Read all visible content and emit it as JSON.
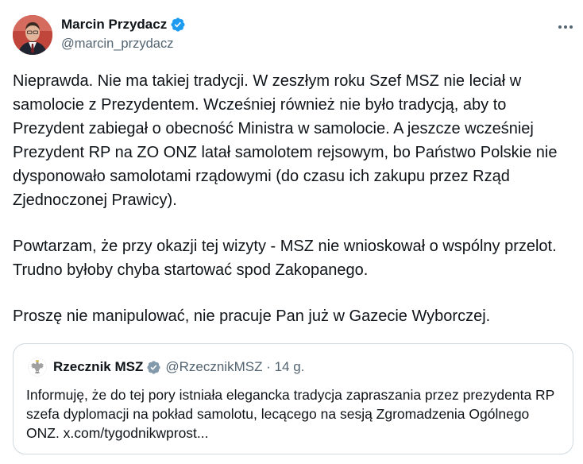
{
  "author": {
    "display_name": "Marcin Przydacz",
    "handle": "@marcin_przydacz"
  },
  "more_icon": "more-horizontal-icon",
  "verified_color": "#1d9bf0",
  "tweet": {
    "paragraphs": [
      "Nieprawda. Nie ma takiej tradycji. W zeszłym roku Szef MSZ nie leciał w samolocie z Prezydentem. Wcześniej również nie było tradycją, aby to Prezydent zabiegał o obecność Ministra w samolocie. A jeszcze wcześniej Prezydent RP na ZO ONZ latał samolotem rejsowym, bo Państwo Polskie nie dysponowało samolotami rządowymi (do czasu ich zakupu przez Rząd Zjednoczonej Prawicy).",
      "Powtarzam, że przy okazji tej wizyty - MSZ nie wnioskował o wspólny przelot. Trudno byłoby chyba startować spod Zakopanego.",
      "Proszę nie manipulować, nie pracuje Pan już w Gazecie Wyborczej."
    ]
  },
  "quote": {
    "display_name": "Rzecznik MSZ",
    "handle_time": "@RzecznikMSZ · 14 g.",
    "avatar_icon": "polish-eagle-icon",
    "text": "Informuję, że do tej pory istniała elegancka tradycja zapraszania przez prezydenta RP szefa dyplomacji na pokład samolotu, lecącego na sesją Zgromadzenia Ogólnego ONZ. x.com/tygodnikwprost..."
  }
}
